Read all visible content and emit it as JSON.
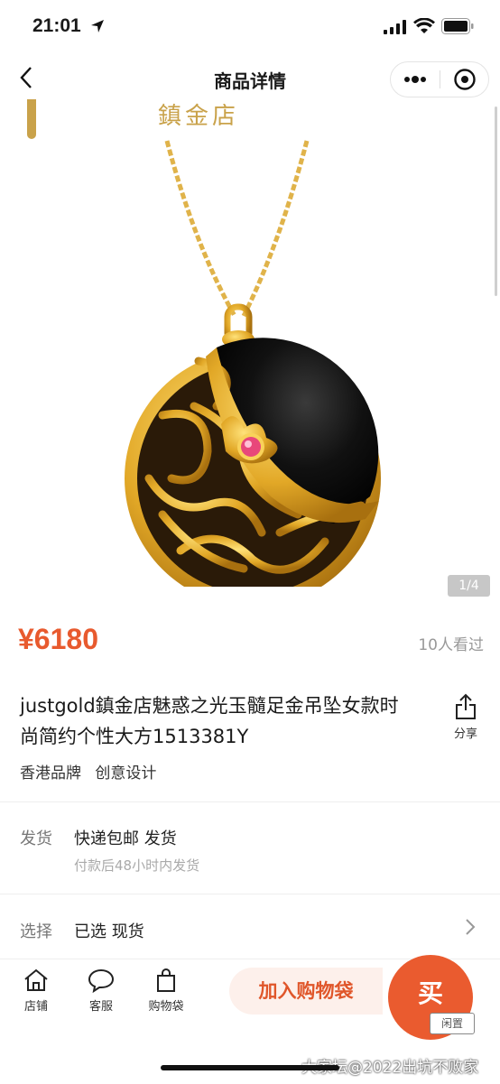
{
  "status": {
    "time": "21:01"
  },
  "nav": {
    "title": "商品详情"
  },
  "hero": {
    "logo_text": "鎮金店",
    "pager": "1/4"
  },
  "product": {
    "price": "¥6180",
    "views": "10人看过",
    "name": "justgold鎮金店魅惑之光玉髓足金吊坠女款时尚简约个性大方1513381Y",
    "share_label": "分享",
    "tags": [
      "香港品牌",
      "创意设计"
    ]
  },
  "delivery": {
    "label": "发货",
    "value": "快递包邮 发货",
    "sub": "付款后48小时内发货"
  },
  "select": {
    "label": "选择",
    "value": "已选 现货"
  },
  "bottom": {
    "store": "店铺",
    "service": "客服",
    "bag": "购物袋",
    "add_cart": "加入购物袋",
    "buy": "买",
    "badge": "闲置",
    "watermark": "大家坛@2022出坑不败家"
  },
  "colors": {
    "accent": "#ea5b2f",
    "price": "#e85a2e",
    "gold": "#c9a24a"
  }
}
